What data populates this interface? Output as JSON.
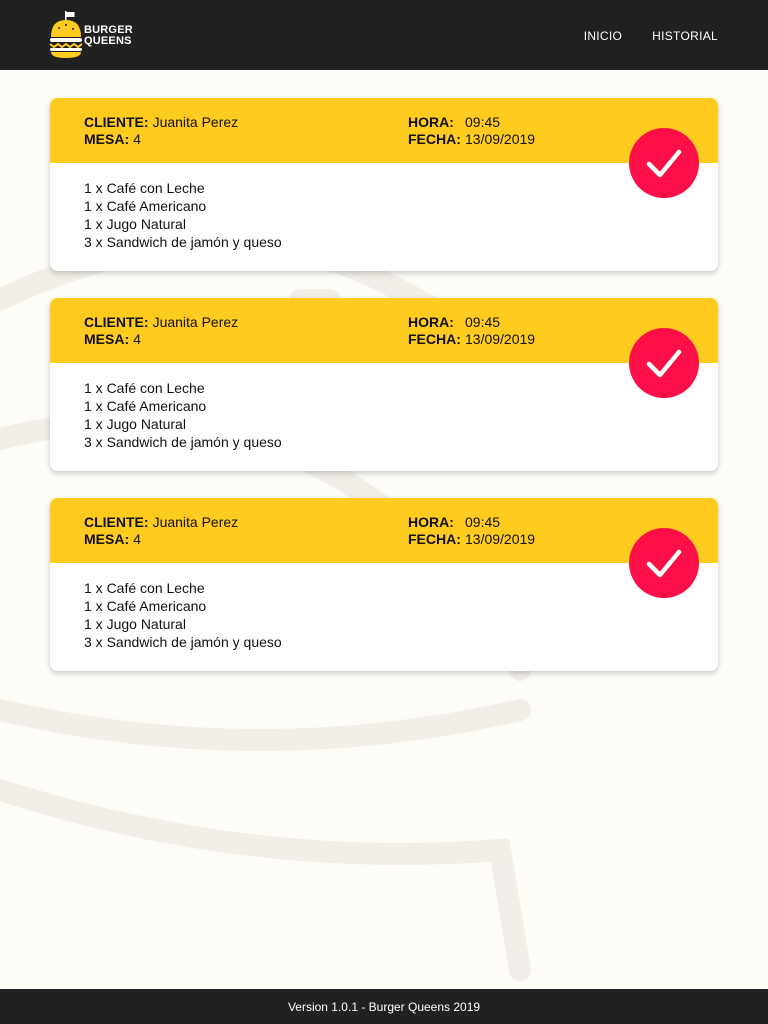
{
  "brand": {
    "line1": "Burger",
    "line2": "Queens"
  },
  "nav": {
    "items": [
      {
        "label": "INICIO"
      },
      {
        "label": "HISTORIAL"
      }
    ]
  },
  "labels": {
    "cliente": "CLIENTE:",
    "mesa": "MESA:",
    "hora": "HORA:",
    "fecha": "FECHA:"
  },
  "orders": [
    {
      "cliente": "Juanita Perez",
      "mesa": "4",
      "hora": "09:45",
      "fecha": "13/09/2019",
      "items": [
        "1 x Café con Leche",
        "1 x Café Americano",
        "1 x Jugo Natural",
        "3 x Sandwich de jamón y queso"
      ]
    },
    {
      "cliente": "Juanita Perez",
      "mesa": "4",
      "hora": "09:45",
      "fecha": "13/09/2019",
      "items": [
        "1 x Café con Leche",
        "1 x Café Americano",
        "1 x Jugo Natural",
        "3 x Sandwich de jamón y queso"
      ]
    },
    {
      "cliente": "Juanita Perez",
      "mesa": "4",
      "hora": "09:45",
      "fecha": "13/09/2019",
      "items": [
        "1 x Café con Leche",
        "1 x Café Americano",
        "1 x Jugo Natural",
        "3 x Sandwich de jamón y queso"
      ]
    }
  ],
  "footer": {
    "text": "Version 1.0.1 - Burger Queens 2019"
  },
  "colors": {
    "header": "#212121",
    "accent": "#ffcb1f",
    "check": "#ff0f47",
    "background": "#fdfcf7"
  },
  "icons": {
    "logo": "burger-crown-icon",
    "check": "check-icon"
  }
}
